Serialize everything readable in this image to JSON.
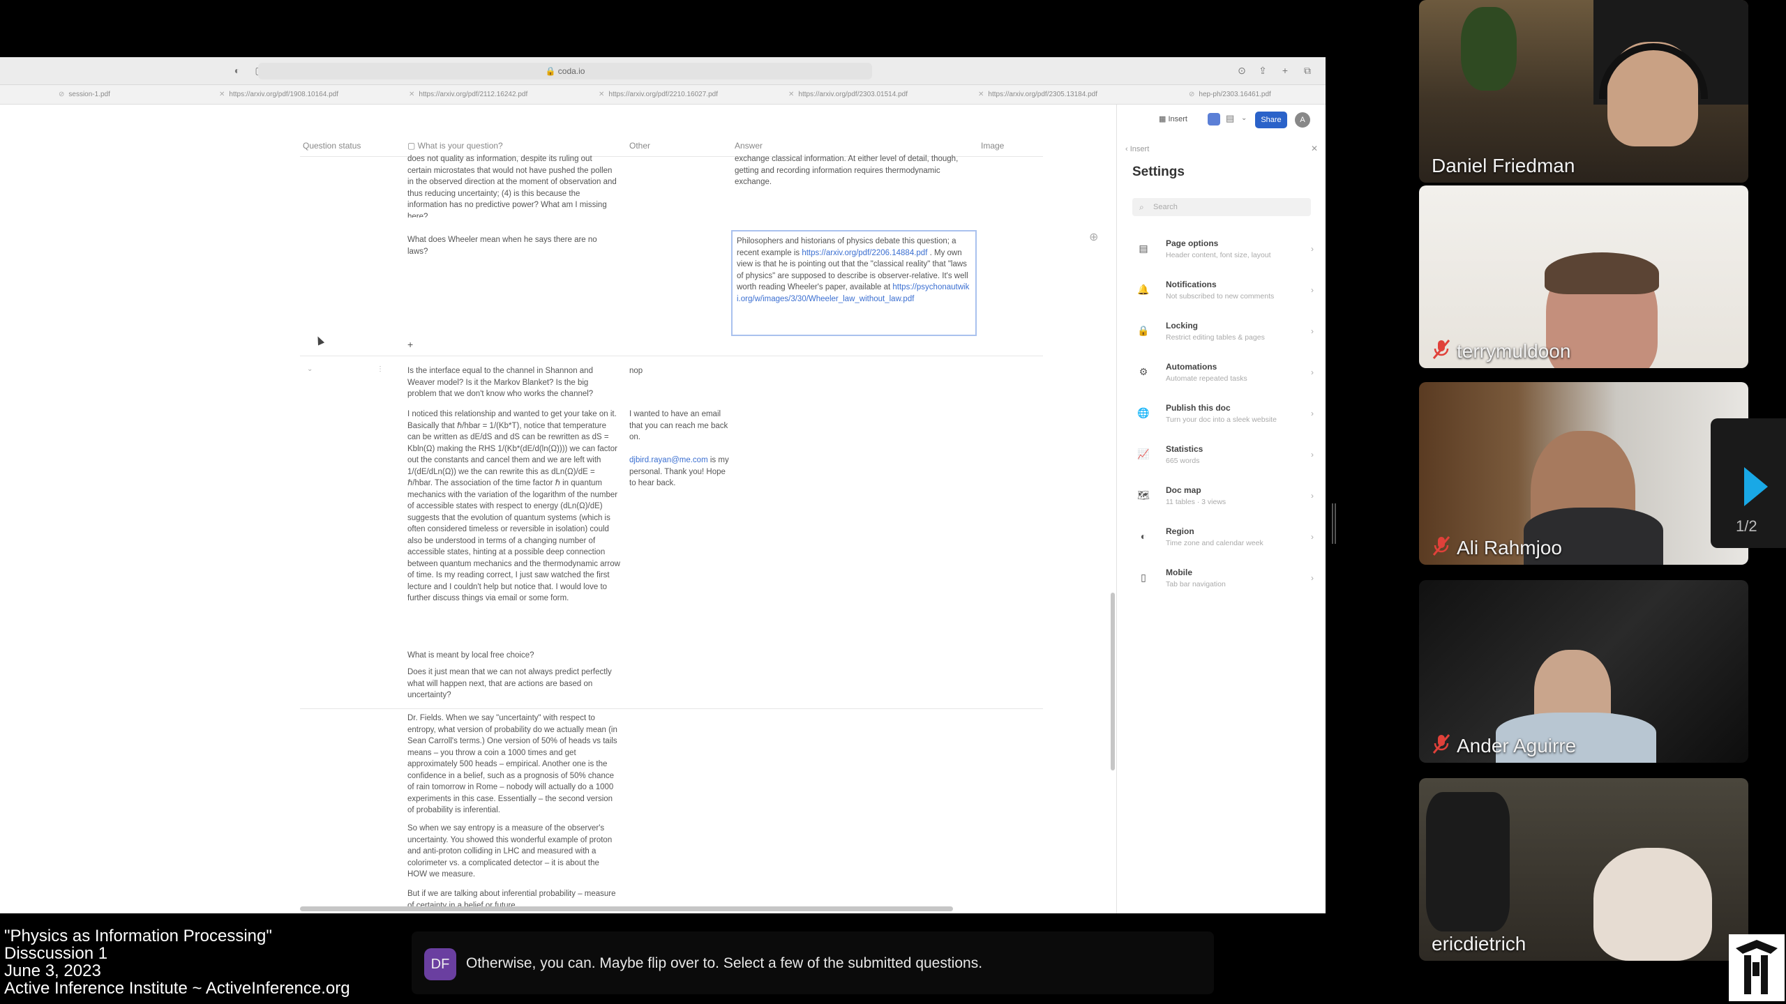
{
  "browser": {
    "url": "coda.io",
    "tabs": [
      "session-1.pdf",
      "https://arxiv.org/pdf/1908.10164.pdf",
      "https://arxiv.org/pdf/2112.16242.pdf",
      "https://arxiv.org/pdf/2210.16027.pdf",
      "https://arxiv.org/pdf/2303.01514.pdf",
      "https://arxiv.org/pdf/2305.13184.pdf",
      "hep-ph/2303.16461.pdf"
    ]
  },
  "table": {
    "headers": [
      "Question status",
      "What is your question?",
      "Other",
      "Answer",
      "Image"
    ],
    "row1_question": "does not quality as information, despite its ruling out certain microstates that would not have pushed the pollen in the observed direction at the moment of observation and thus reducing uncertainty; (4) is this because the information has no predictive power? What am I missing here?",
    "row1_answer": "exchange classical information. At either level of detail, though, getting and recording information requires thermodynamic exchange.",
    "row2_question": "What does Wheeler mean when he says there are no laws?",
    "row2_answer_pre": "Philosophers and historians of physics debate this question; a recent example is ",
    "row2_answer_link1": "https://arxiv.org/pdf/2206.14884.pdf",
    "row2_answer_mid": " . My own view is that he is pointing out that the \"classical reality\" that \"laws of physics\" are supposed to describe is observer-relative. It's well worth reading Wheeler's paper, available at ",
    "row2_answer_link2": "https://psychonautwiki.org/w/images/3/30/Wheeler_law_without_law.pdf",
    "add_row": "+",
    "row3_question": "Is the interface equal to the channel in Shannon and Weaver model? Is it the Markov Blanket? Is the big problem that we don't know who works the channel?",
    "row3_other": "nop",
    "row4_question": "I noticed this relationship and wanted to get your take on it. Basically that ℏ/hbar = 1/(Kb*T), notice that temperature can be written as dE/dS and dS can be rewritten as dS = Kbln(Ω) making the RHS 1/(Kb*(dE/d(ln(Ω)))) we can factor out the constants and cancel them and we are left with 1/(dE/dLn(Ω)) we the can rewrite this as dLn(Ω)/dE = ℏ/hbar. The association of the time factor ℏ in quantum mechanics with the variation of the logarithm of the number of accessible states with respect to energy (dLn(Ω)/dE) suggests that the evolution of quantum systems (which is often considered timeless or reversible in isolation) could also be understood in terms of a changing number of accessible states, hinting at a possible deep connection between quantum mechanics and the thermodynamic arrow of time. Is my reading correct, I just saw watched the first lecture and I couldn't help but notice that. I would love to further discuss things via email or some form.",
    "row4_other_pre": "I wanted to have an email that you can reach me back on.",
    "row4_other_link": "djbird.rayan@me.com",
    "row4_other_post": " is my personal. Thank you! Hope to hear back.",
    "row5_question": "What is meant by local free choice?",
    "row6_question": "Does it just mean that we can not always predict perfectly what will happen next, that are actions are based on uncertainty?",
    "row7_question": "Dr. Fields. When we say \"uncertainty\" with respect to entropy, what version of probability do we actually mean (in Sean Carroll's terms.) One version of 50% of heads vs tails means – you throw a coin a 1000 times and get approximately 500 heads – empirical. Another one is the confidence in a belief, such as a prognosis of 50% chance of rain tomorrow in Rome – nobody will actually do a 1000 experiments in this case. Essentially – the second version of probability is inferential.",
    "row8_question": "So when we say entropy is a measure of the observer's uncertainty. You showed this wonderful example of proton and anti-proton colliding in LHC and measured with a colorimeter vs. a complicated detector – it is about the HOW we measure.",
    "row9_question": "But if we are talking about inferential probability – measure of certainty in a belief or future"
  },
  "settings": {
    "toolbar_insert": "Insert",
    "share_label": "Share",
    "avatar_letter": "A",
    "back_label": "Insert",
    "title": "Settings",
    "search_placeholder": "Search",
    "items": [
      {
        "title": "Page options",
        "sub": "Header content, font size, layout",
        "icon": "▤"
      },
      {
        "title": "Notifications",
        "sub": "Not subscribed to new comments",
        "icon": "🔔"
      },
      {
        "title": "Locking",
        "sub": "Restrict editing tables & pages",
        "icon": "🔒"
      },
      {
        "title": "Automations",
        "sub": "Automate repeated tasks",
        "icon": "⚙"
      },
      {
        "title": "Publish this doc",
        "sub": "Turn your doc into a sleek website",
        "icon": "🌐"
      },
      {
        "title": "Statistics",
        "sub": "665 words",
        "icon": "📈"
      },
      {
        "title": "Doc map",
        "sub": "11 tables · 3 views",
        "icon": "🗺"
      },
      {
        "title": "Region",
        "sub": "Time zone and calendar week",
        "icon": "◐"
      },
      {
        "title": "Mobile",
        "sub": "Tab bar navigation",
        "icon": "▯"
      }
    ]
  },
  "participants": [
    {
      "name": "Daniel Friedman",
      "muted": false
    },
    {
      "name": "terrymuldoon",
      "muted": true
    },
    {
      "name": "Ali Rahmjoo",
      "muted": true
    },
    {
      "name": "Ander Aguirre",
      "muted": true
    },
    {
      "name": "ericdietrich",
      "muted": false
    }
  ],
  "gallery": {
    "page_indicator": "1/2"
  },
  "caption": {
    "line1": "\"Physics as Information Processing\"",
    "line2": "Disscussion 1",
    "line3": "June 3, 2023",
    "line4": "Active Inference Institute ~ ActiveInference.org"
  },
  "subtitle": {
    "speaker_initials": "DF",
    "text": "Otherwise, you can. Maybe flip over to. Select a few of the submitted questions."
  },
  "colors": {
    "accent": "#2a62c9",
    "link": "#3b6fd1",
    "mute_red": "#e0413a",
    "next_arrow": "#19a8e6"
  }
}
